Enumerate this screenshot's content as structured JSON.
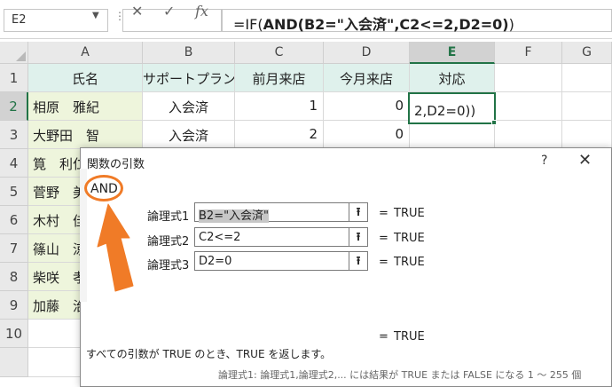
{
  "formula_bar": {
    "name_box": "E2",
    "cancel_icon": "✕",
    "enter_icon": "✓",
    "fx_label": "fx",
    "formula_prefix": "=IF(",
    "formula_bold": "AND(B2=\"入会済\",C2<=2,D2=0)",
    "formula_suffix": ")"
  },
  "columns": [
    "A",
    "B",
    "C",
    "D",
    "E",
    "F",
    "G"
  ],
  "rows": [
    "1",
    "2",
    "3",
    "4",
    "5",
    "6",
    "7",
    "8",
    "9",
    "10"
  ],
  "table": {
    "headers": [
      "氏名",
      "サポートプラン",
      "前月来店",
      "今月来店",
      "対応"
    ],
    "r2": {
      "name": "相原　雅紀",
      "plan": "入会済",
      "prev": "1",
      "cur": "0",
      "active": "2,D2=0))"
    },
    "r3": {
      "name": "大野田　智",
      "plan": "入会済",
      "prev": "2",
      "cur": "0"
    },
    "names_partial": [
      "筧　利仁",
      "菅野　美",
      "木村　佳",
      "篠山　涼",
      "柴咲　孝",
      "加藤　治"
    ]
  },
  "dialog": {
    "title": "関数の引数",
    "help": "?",
    "close": "✕",
    "function_name": "AND",
    "args": [
      {
        "label": "論理式1",
        "value": "B2=\"入会済\"",
        "result": "TRUE"
      },
      {
        "label": "論理式2",
        "value": "C2<=2",
        "result": "TRUE"
      },
      {
        "label": "論理式3",
        "value": "D2=0",
        "result": "TRUE"
      }
    ],
    "equals": "=",
    "total_result": "TRUE",
    "description": "すべての引数が TRUE のとき、TRUE を返します。",
    "description2": "論理式1: 論理式1,論理式2,... には結果が TRUE または FALSE になる 1 ～ 255 個"
  },
  "colors": {
    "accent": "#217346",
    "highlight": "#f07b27"
  }
}
